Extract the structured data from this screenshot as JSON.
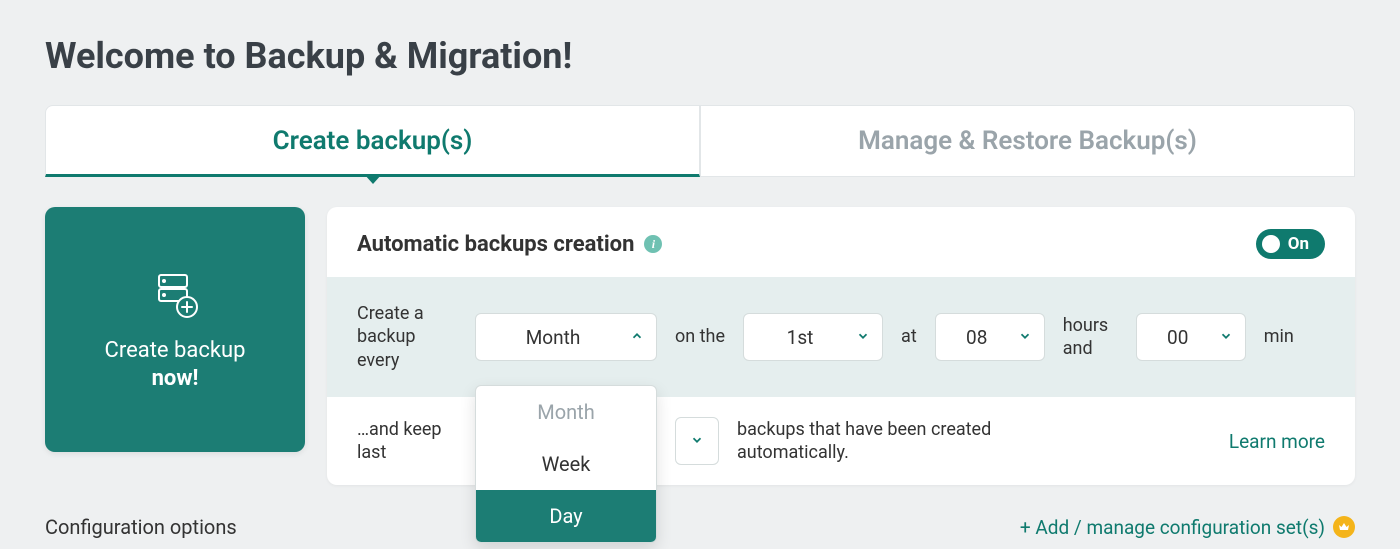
{
  "page_title": "Welcome to Backup & Migration!",
  "tabs": [
    {
      "label": "Create backup(s)",
      "active": true
    },
    {
      "label": "Manage & Restore Backup(s)",
      "active": false
    }
  ],
  "create_now": {
    "line1": "Create backup",
    "line2": "now!"
  },
  "panel": {
    "title": "Automatic backups creation",
    "toggle": {
      "state": "On"
    },
    "schedule": {
      "label_every": "Create a backup every",
      "period": {
        "value": "Month",
        "options": [
          "Month",
          "Week",
          "Day"
        ],
        "highlighted": "Day"
      },
      "label_on_the": "on the",
      "day_of_month": "1st",
      "label_at": "at",
      "hour": "08",
      "label_hours_and": "hours and",
      "minute": "00",
      "label_min_suffix": "min"
    },
    "keep": {
      "label_prefix": "…and keep last",
      "label_suffix": "backups that have been created automatically.",
      "learn_more": "Learn more"
    }
  },
  "footer": {
    "config_label": "Configuration options",
    "add_manage": "+ Add / manage configuration set(s)"
  }
}
